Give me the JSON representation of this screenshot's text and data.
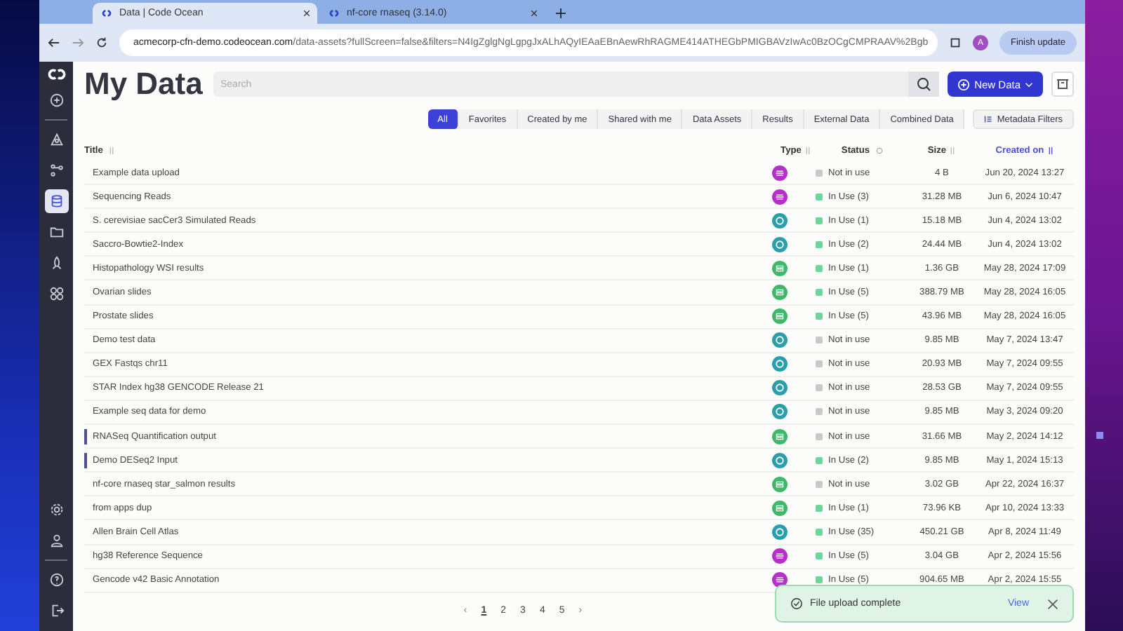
{
  "browser": {
    "tabs": [
      {
        "title": "Data | Code Ocean",
        "selected": true
      },
      {
        "title": "nf-core rnaseq (3.14.0)",
        "selected": false
      }
    ],
    "url_domain": "acmecorp-cfn-demo.codeocean.com",
    "url_path": "/data-assets?fullScreen=false&filters=N4IgZglgNgLgpgJxALhAQyIEAaEBnAewRhRAGME414ATHEGbPMIGBAVzIwAc0BzOCgCMPRAAV%2Bgb",
    "profile": "A",
    "update_button": "Finish update"
  },
  "sidebar": {
    "items": [
      {
        "kind": "plus",
        "selected": false
      },
      {
        "kind": "capsule",
        "selected": false
      },
      {
        "kind": "flow",
        "selected": false
      },
      {
        "kind": "database",
        "selected": true
      },
      {
        "kind": "folder",
        "selected": false
      },
      {
        "kind": "rocket",
        "selected": false
      },
      {
        "kind": "apps",
        "selected": false
      }
    ],
    "bottom_items": [
      {
        "kind": "gear",
        "selected": false
      },
      {
        "kind": "user",
        "selected": false
      },
      {
        "kind": "help",
        "selected": false
      },
      {
        "kind": "logout",
        "selected": false
      }
    ]
  },
  "page_title": "My Data",
  "search": {
    "placeholder": "Search"
  },
  "new_button": "New Data",
  "filters": [
    {
      "label": "All",
      "selected": true
    },
    {
      "label": "Favorites",
      "selected": false
    },
    {
      "label": "Created by me",
      "selected": false
    },
    {
      "label": "Shared with me",
      "selected": false
    },
    {
      "label": "Data Assets",
      "selected": false
    },
    {
      "label": "Results",
      "selected": false
    },
    {
      "label": "External Data",
      "selected": false
    },
    {
      "label": "Combined Data",
      "selected": false
    }
  ],
  "metadata_button": "Metadata Filters",
  "table": {
    "columns": [
      {
        "label": "Title",
        "sorted": false
      },
      {
        "label": "Type",
        "sorted": false
      },
      {
        "label": "Status",
        "sorted": false
      },
      {
        "label": "Size",
        "sorted": false
      },
      {
        "label": "Created on",
        "sorted": true
      }
    ],
    "rows": [
      {
        "title": "Example data upload",
        "kind": "result",
        "status": "Not in use",
        "in_use": false,
        "size": "4 B",
        "created": "Jun 20, 2024 13:27",
        "flagged": false
      },
      {
        "title": "Sequencing Reads",
        "kind": "result",
        "status": "In Use  (3)",
        "in_use": true,
        "size": "31.28 MB",
        "created": "Jun 6, 2024 10:47",
        "flagged": false
      },
      {
        "title": "S. cerevisiae sacCer3 Simulated Reads",
        "kind": "external",
        "status": "In Use  (1)",
        "in_use": true,
        "size": "15.18 MB",
        "created": "Jun 4, 2024 13:02",
        "flagged": false
      },
      {
        "title": "Saccro-Bowtie2-Index",
        "kind": "external",
        "status": "In Use  (2)",
        "in_use": true,
        "size": "24.44 MB",
        "created": "Jun 4, 2024 13:02",
        "flagged": false
      },
      {
        "title": "Histopathology WSI results",
        "kind": "dataset",
        "status": "In Use  (1)",
        "in_use": true,
        "size": "1.36 GB",
        "created": "May 28, 2024 17:09",
        "flagged": false
      },
      {
        "title": "Ovarian slides",
        "kind": "dataset",
        "status": "In Use  (5)",
        "in_use": true,
        "size": "388.79 MB",
        "created": "May 28, 2024 16:05",
        "flagged": false
      },
      {
        "title": "Prostate slides",
        "kind": "dataset",
        "status": "In Use  (5)",
        "in_use": true,
        "size": "43.96 MB",
        "created": "May 28, 2024 16:05",
        "flagged": false
      },
      {
        "title": "Demo test data",
        "kind": "external",
        "status": "Not in use",
        "in_use": false,
        "size": "9.85 MB",
        "created": "May 7, 2024 13:47",
        "flagged": false
      },
      {
        "title": "GEX Fastqs chr11",
        "kind": "external",
        "status": "Not in use",
        "in_use": false,
        "size": "20.93 MB",
        "created": "May 7, 2024 09:55",
        "flagged": false
      },
      {
        "title": "STAR Index hg38 GENCODE Release 21",
        "kind": "external",
        "status": "Not in use",
        "in_use": false,
        "size": "28.53 GB",
        "created": "May 7, 2024 09:55",
        "flagged": false
      },
      {
        "title": "Example seq data for demo",
        "kind": "external",
        "status": "Not in use",
        "in_use": false,
        "size": "9.85 MB",
        "created": "May 3, 2024 09:20",
        "flagged": false
      },
      {
        "title": "RNASeq Quantification output",
        "kind": "dataset",
        "status": "Not in use",
        "in_use": false,
        "size": "31.66 MB",
        "created": "May 2, 2024 14:12",
        "flagged": true
      },
      {
        "title": "Demo DESeq2 Input",
        "kind": "external",
        "status": "In Use  (2)",
        "in_use": true,
        "size": "9.85 MB",
        "created": "May 1, 2024 15:13",
        "flagged": true
      },
      {
        "title": "nf-core rnaseq star_salmon results",
        "kind": "dataset",
        "status": "Not in use",
        "in_use": false,
        "size": "3.02 GB",
        "created": "Apr 22, 2024 16:37",
        "flagged": false
      },
      {
        "title": "from apps dup",
        "kind": "dataset",
        "status": "In Use  (1)",
        "in_use": true,
        "size": "73.96 KB",
        "created": "Apr 10, 2024 13:33",
        "flagged": false
      },
      {
        "title": "Allen Brain Cell Atlas",
        "kind": "external",
        "status": "In Use  (35)",
        "in_use": true,
        "size": "450.21 GB",
        "created": "Apr 8, 2024 11:49",
        "flagged": false
      },
      {
        "title": "hg38 Reference Sequence",
        "kind": "result",
        "status": "In Use  (5)",
        "in_use": true,
        "size": "3.04 GB",
        "created": "Apr 2, 2024 15:56",
        "flagged": false
      },
      {
        "title": "Gencode v42 Basic Annotation",
        "kind": "result",
        "status": "In Use  (5)",
        "in_use": true,
        "size": "904.65 MB",
        "created": "Apr 2, 2024 15:55",
        "flagged": false
      }
    ]
  },
  "pagination": {
    "prev": "‹",
    "next": "›",
    "pages": [
      {
        "label": "1",
        "selected": true
      },
      {
        "label": "2",
        "selected": false
      },
      {
        "label": "3",
        "selected": false
      },
      {
        "label": "4",
        "selected": false
      },
      {
        "label": "5",
        "selected": false
      }
    ]
  },
  "toast": {
    "message": "File upload complete",
    "action": "View"
  }
}
